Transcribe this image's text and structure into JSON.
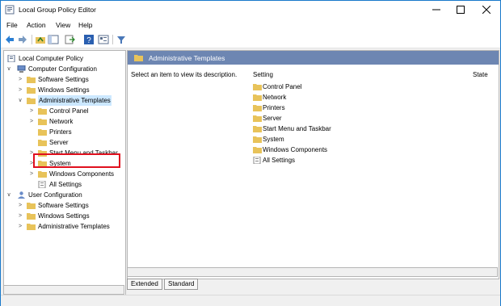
{
  "window": {
    "title": "Local Group Policy Editor"
  },
  "menu": [
    "File",
    "Action",
    "View",
    "Help"
  ],
  "tree": {
    "root": "Local Computer Policy",
    "computer_config": "Computer Configuration",
    "cc_software": "Software Settings",
    "cc_windows": "Windows Settings",
    "cc_admin": "Administrative Templates",
    "cc_control_panel": "Control Panel",
    "cc_network": "Network",
    "cc_printers": "Printers",
    "cc_server": "Server",
    "cc_start_menu": "Start Menu and Taskbar",
    "cc_system": "System",
    "cc_windows_components": "Windows Components",
    "cc_all_settings": "All Settings",
    "user_config": "User Configuration",
    "uc_software": "Software Settings",
    "uc_windows": "Windows Settings",
    "uc_admin": "Administrative Templates"
  },
  "right": {
    "header": "Administrative Templates",
    "description": "Select an item to view its description.",
    "col_setting": "Setting",
    "col_state": "State",
    "items": [
      "Control Panel",
      "Network",
      "Printers",
      "Server",
      "Start Menu and Taskbar",
      "System",
      "Windows Components",
      "All Settings"
    ]
  },
  "tabs": {
    "extended": "Extended",
    "standard": "Standard"
  },
  "colors": {
    "accent": "#1979ca",
    "header_bg": "#6d86b2",
    "highlight": "#e0101e",
    "folder": "#e8c35a"
  }
}
